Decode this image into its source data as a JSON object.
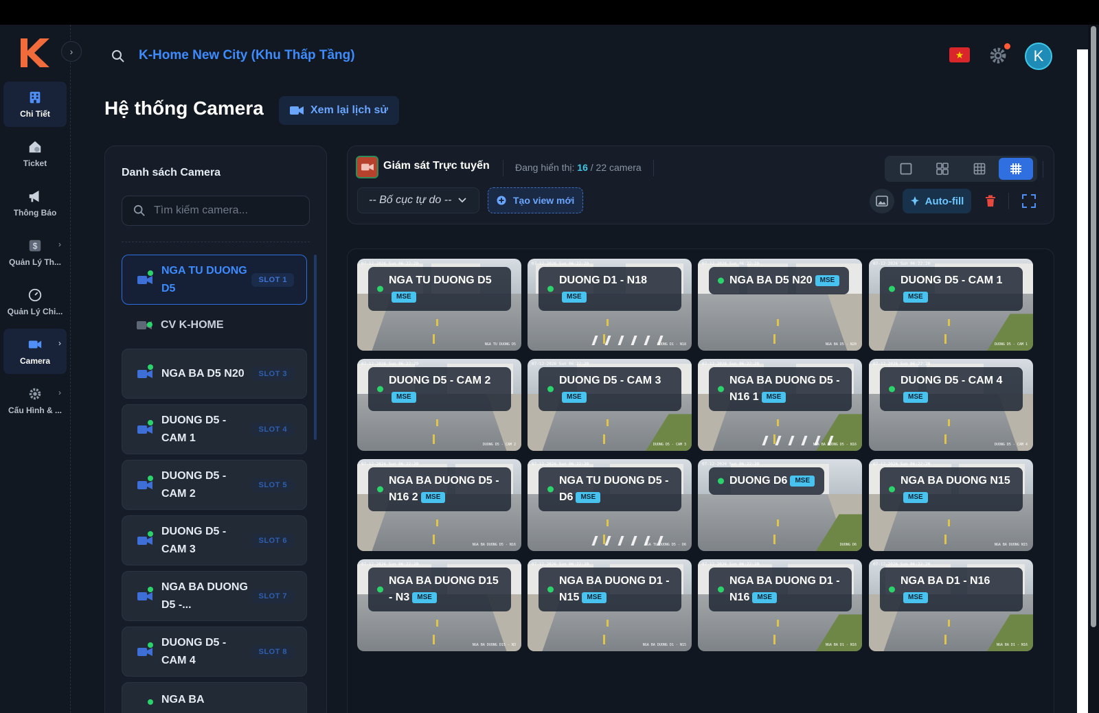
{
  "sidebar": {
    "items": [
      {
        "label": "Chi Tiết",
        "icon": "building-icon",
        "active": true,
        "chevron": false
      },
      {
        "label": "Ticket",
        "icon": "house-gear-icon",
        "active": false,
        "chevron": false
      },
      {
        "label": "Thông Báo",
        "icon": "megaphone-icon",
        "active": false,
        "chevron": false
      },
      {
        "label": "Quản Lý Th...",
        "icon": "dollar-icon",
        "active": false,
        "chevron": true
      },
      {
        "label": "Quản Lý Chi...",
        "icon": "gauge-icon",
        "active": false,
        "chevron": true
      },
      {
        "label": "Camera",
        "icon": "video-camera-icon",
        "active": true,
        "chevron": true
      },
      {
        "label": "Cấu Hình & ...",
        "icon": "gear-icon",
        "active": false,
        "chevron": true
      }
    ]
  },
  "header": {
    "project": "K-Home New City (Khu Thấp Tầng)",
    "avatar_letter": "K",
    "flag": "★"
  },
  "page": {
    "title": "Hệ thống Camera",
    "history_button": "Xem lại lịch sử"
  },
  "camera_list": {
    "title": "Danh sách Camera",
    "search_placeholder": "Tìm kiếm camera...",
    "items": [
      {
        "name": "NGA TU DUONG D5",
        "slot": "SLOT 1",
        "state": "active"
      },
      {
        "name": "CV K-HOME",
        "slot": "",
        "state": "plain"
      },
      {
        "name": "NGA BA D5 N20",
        "slot": "SLOT 3",
        "state": "normal"
      },
      {
        "name": "DUONG D5 - CAM 1",
        "slot": "SLOT 4",
        "state": "normal"
      },
      {
        "name": "DUONG D5 - CAM 2",
        "slot": "SLOT 5",
        "state": "normal"
      },
      {
        "name": "DUONG D5 - CAM 3",
        "slot": "SLOT 6",
        "state": "normal"
      },
      {
        "name": "NGA BA DUONG D5 -...",
        "slot": "SLOT 7",
        "state": "normal"
      },
      {
        "name": "DUONG D5 - CAM 4",
        "slot": "SLOT 8",
        "state": "normal"
      },
      {
        "name": "NGA BA",
        "slot": "",
        "state": "normal"
      }
    ]
  },
  "monitor": {
    "title": "Giám sát Trực tuyến",
    "showing_label": "Đang hiển thị:",
    "showing_count": "16",
    "showing_total": "/ 22 camera",
    "layout_select": "-- Bố cục tự do --",
    "new_view_button": "Tạo view mới",
    "autofill_button": "Auto-fill",
    "layouts": [
      "1x1",
      "2x2",
      "3x3",
      "4x4"
    ],
    "active_layout": "4x4"
  },
  "tiles": [
    {
      "name": "NGA TU DUONG D5",
      "badge": "MSE",
      "time": "07-12-2026 Sun 06:22:20",
      "tag": "NGA TU DUONG D5"
    },
    {
      "name": "DUONG D1 - N18",
      "badge": "MSE",
      "time": "07-12-2026 Sun 06:22:20",
      "tag": "DUONG D1 - N18"
    },
    {
      "name": "NGA BA D5 N20",
      "badge": "MSE",
      "time": "07-12-2026 Sun 06:22:20",
      "tag": "NGA BA D5 - N20"
    },
    {
      "name": "DUONG D5 - CAM 1",
      "badge": "MSE",
      "time": "07-12-2026 Sun 06:22:20",
      "tag": "DUONG D5 - CAM 1"
    },
    {
      "name": "DUONG D5 - CAM 2",
      "badge": "MSE",
      "time": "07-12-2026 Sun 06:22:20",
      "tag": "DUONG D5 - CAM 2"
    },
    {
      "name": "DUONG D5 - CAM 3",
      "badge": "MSE",
      "time": "07-12-2026 Sun 06:22:20",
      "tag": "DUONG D5 - CAM 3"
    },
    {
      "name": "NGA BA DUONG D5 - N16 1",
      "badge": "MSE",
      "time": "07-12-2026 Sun 06:22:20",
      "tag": "NGA BA DUONG D5 - N16"
    },
    {
      "name": "DUONG D5 - CAM 4",
      "badge": "MSE",
      "time": "07-12-2026 Sun 06:22:20",
      "tag": "DUONG D5 - CAM 4"
    },
    {
      "name": "NGA BA DUONG D5 - N16 2",
      "badge": "MSE",
      "time": "07-12-2026 Sun 06:22:20",
      "tag": "NGA BA DUONG D5 - N16"
    },
    {
      "name": "NGA TU DUONG D5 - D6",
      "badge": "MSE",
      "time": "07-12-2026 Sun 06:22:20",
      "tag": "NGA TU DUONG D5 - D6"
    },
    {
      "name": "DUONG D6",
      "badge": "MSE",
      "time": "07-12-2026 Sun 06:22:20",
      "tag": "DUONG D6"
    },
    {
      "name": "NGA BA DUONG N15",
      "badge": "MSE",
      "time": "07-12-2026 Sun 06:22:20",
      "tag": "NGA BA DUONG N15"
    },
    {
      "name": "NGA BA DUONG D15 - N3",
      "badge": "MSE",
      "time": "07-12-2026 Sun 06:22:20",
      "tag": "NGA BA DUONG D15 - N3"
    },
    {
      "name": "NGA BA DUONG D1 - N15",
      "badge": "MSE",
      "time": "07-12-2026 Sun 06:22:20",
      "tag": "NGA BA DUONG D1 - N15"
    },
    {
      "name": "NGA BA DUONG D1 - N16",
      "badge": "MSE",
      "time": "07-12-2026 Sun 06:22:20",
      "tag": "NGA BA D1 - N16"
    },
    {
      "name": "NGA BA D1 - N16",
      "badge": "MSE",
      "time": "07-12-2026 Sun 06:22:20",
      "tag": "NGA BA D1 - N16"
    }
  ],
  "colors": {
    "accent": "#3d8bfd",
    "online": "#2bd46b",
    "badge": "#48c3f0",
    "brand": "#f26b3a"
  }
}
